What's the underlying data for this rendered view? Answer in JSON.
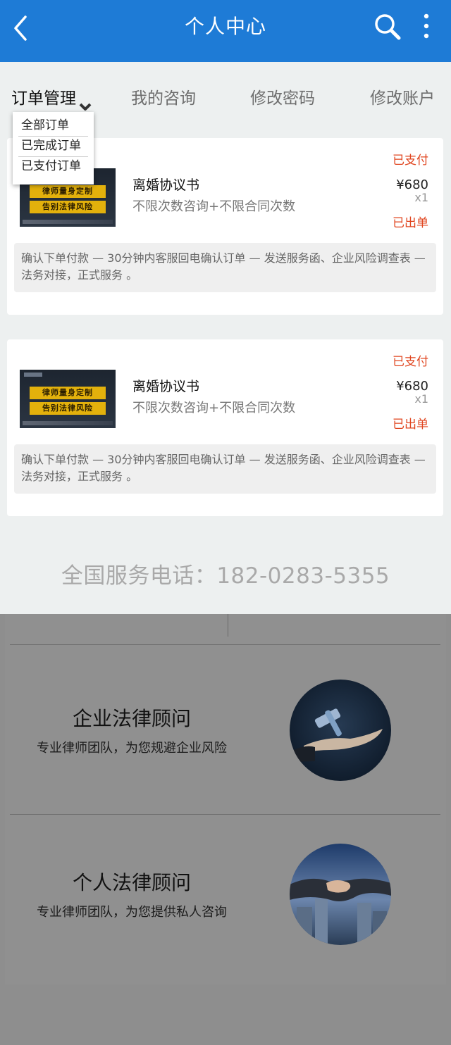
{
  "header": {
    "title": "个人中心"
  },
  "tabs": [
    {
      "label": "订单管理"
    },
    {
      "label": "我的咨询"
    },
    {
      "label": "修改密码"
    },
    {
      "label": "修改账户"
    }
  ],
  "dropdown": {
    "items": [
      "全部订单",
      "已完成订单",
      "已支付订单"
    ]
  },
  "orders": [
    {
      "thumb_line1": "律师量身定制",
      "thumb_line2": "告别法律风险",
      "name": "离婚协议书",
      "desc": "不限次数咨询+不限合同次数",
      "pay_status": "已支付",
      "price": "¥680",
      "qty": "x1",
      "ship_status": "已出单",
      "steps": "确认下单付款 — 30分钟内客服回电确认订单 — 发送服务函、企业风险调查表 — 法务对接，正式服务 。"
    },
    {
      "thumb_line1": "律师量身定制",
      "thumb_line2": "告别法律风险",
      "name": "离婚协议书",
      "desc": "不限次数咨询+不限合同次数",
      "pay_status": "已支付",
      "price": "¥680",
      "qty": "x1",
      "ship_status": "已出单",
      "steps": "确认下单付款 — 30分钟内客服回电确认订单 — 发送服务函、企业风险调查表 — 法务对接，正式服务 。"
    }
  ],
  "hotline": "全国服务电话：182-0283-5355",
  "services": [
    {
      "title": "企业法律顾问",
      "desc": "专业律师团队，为您规避企业风险",
      "icon": "gavel-hand-icon"
    },
    {
      "title": "个人法律顾问",
      "desc": "专业律师团队，为您提供私人咨询",
      "icon": "handshake-icon"
    }
  ],
  "colors": {
    "header_bg": "#1e7bd6",
    "status_red": "#e0451f",
    "overlay_gray": "#8e8e8e"
  }
}
